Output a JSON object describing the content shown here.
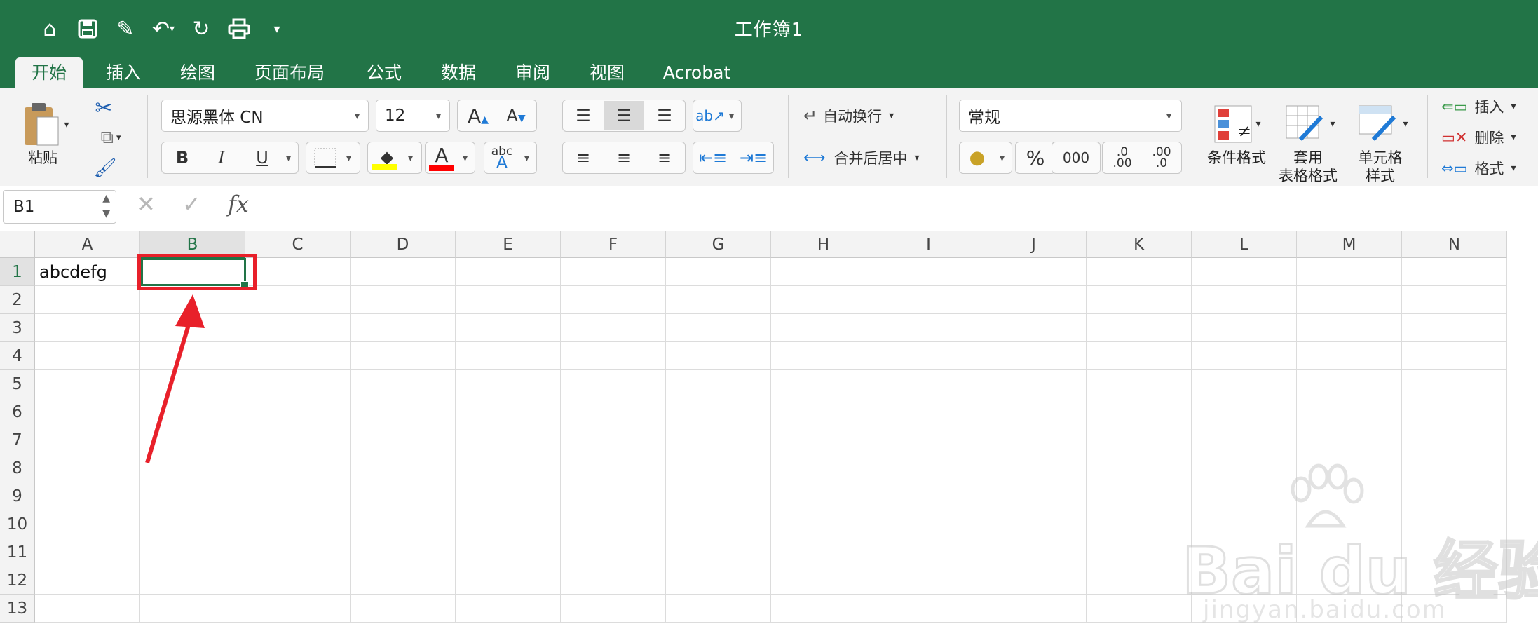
{
  "window": {
    "title": "工作簿1"
  },
  "tabs": [
    "开始",
    "插入",
    "绘图",
    "页面布局",
    "公式",
    "数据",
    "审阅",
    "视图",
    "Acrobat"
  ],
  "active_tab": "开始",
  "ribbon": {
    "paste_label": "粘贴",
    "font_name": "思源黑体 CN",
    "font_size": "12",
    "bold": "B",
    "italic": "I",
    "underline": "U",
    "font_color_letter": "A",
    "wrap_text": "自动换行",
    "merge_center": "合并后居中",
    "number_format": "常规",
    "percent": "%",
    "thousands": "000",
    "conditional_format": "条件格式",
    "table_format": "套用\n表格格式",
    "cell_style": "单元格\n样式",
    "insert": "插入",
    "delete": "删除",
    "format": "格式",
    "abc": "abc",
    "inc_decimal": ".00",
    "dec_decimal": ".0",
    "highlight_color": "#ffff00",
    "font_color": "#ff0000"
  },
  "formula_bar": {
    "name_box": "B1",
    "fx": "fx",
    "cancel": "✕",
    "confirm": "✓"
  },
  "sheet": {
    "columns": [
      "A",
      "B",
      "C",
      "D",
      "E",
      "F",
      "G",
      "H",
      "I",
      "J",
      "K",
      "L",
      "M",
      "N"
    ],
    "rows": [
      "1",
      "2",
      "3",
      "4",
      "5",
      "6",
      "7",
      "8",
      "9",
      "10",
      "11",
      "12",
      "13"
    ],
    "cells": {
      "A1": "abcdefg"
    },
    "selected_cell": "B1"
  },
  "watermark": {
    "text": "Bai du 经验",
    "url": "jingyan.baidu.com"
  },
  "colors": {
    "brand": "#227447",
    "annotation": "#e8202a"
  }
}
